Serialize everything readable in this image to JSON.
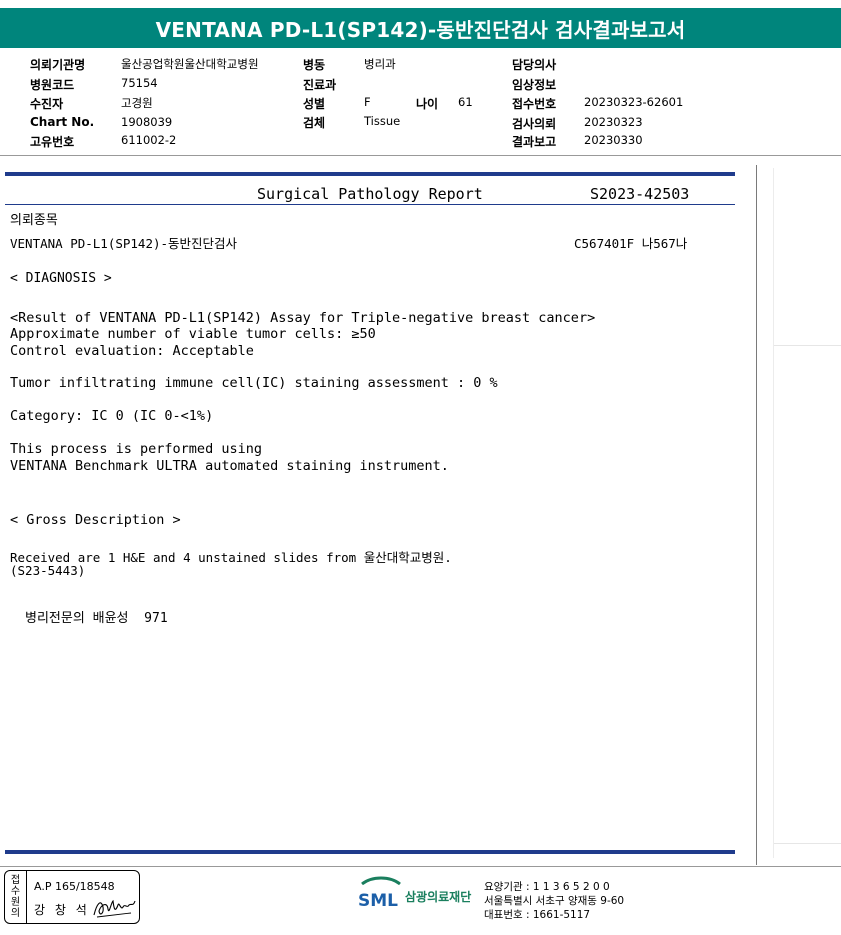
{
  "header": {
    "title": "VENTANA PD-L1(SP142)-동반진단검사 검사결과보고서"
  },
  "patient": {
    "col1": [
      {
        "label": "의뢰기관명",
        "value": "울산공업학원울산대학교병원"
      },
      {
        "label": "병원코드",
        "value": "75154"
      },
      {
        "label": "수진자",
        "value": "고경원"
      },
      {
        "label": "Chart No.",
        "value": "1908039"
      },
      {
        "label": "고유번호",
        "value": "611002-2"
      }
    ],
    "col2": [
      {
        "label": "병동",
        "value": "병리과"
      },
      {
        "label": "진료과",
        "value": ""
      },
      {
        "label": "성별",
        "value": "F"
      },
      {
        "label": "검체",
        "value": "Tissue"
      }
    ],
    "age": {
      "label": "나이",
      "value": "61"
    },
    "col3": [
      {
        "label": "담당의사",
        "value": ""
      },
      {
        "label": "임상정보",
        "value": ""
      },
      {
        "label": "접수번호",
        "value": "20230323-62601"
      },
      {
        "label": "검사의뢰",
        "value": "20230323"
      },
      {
        "label": "결과보고",
        "value": "20230330"
      }
    ]
  },
  "report": {
    "title": "Surgical Pathology Report",
    "report_no": "S2023-42503",
    "request_label": "의뢰종목",
    "request_item": "VENTANA PD-L1(SP142)-동반진단검사",
    "request_code": "C567401F 나567나",
    "diagnosis_header": "< DIAGNOSIS >",
    "result_header": "<Result of VENTANA PD-L1(SP142) Assay for Triple-negative breast cancer>",
    "viable_cells": "Approximate number of viable tumor cells: ≥50",
    "control": "Control evaluation: Acceptable",
    "ic_assessment": "Tumor infiltrating immune cell(IC) staining assessment : 0 %",
    "category": "Category: IC 0 (IC 0-<1%)",
    "process_1": "This process is performed using",
    "process_2": "VENTANA Benchmark ULTRA automated staining instrument.",
    "gross_header": "< Gross Description >",
    "gross_1": "Received are 1 H&E and 4 unstained slides from 울산대학교병원.",
    "gross_2": "(S23-5443)",
    "pathologist": "병리전문의 배윤성  971"
  },
  "footer": {
    "stamp_side": [
      "접",
      "수",
      "원",
      "의"
    ],
    "stamp_ap": "A.P 165/18548",
    "stamp_name": "강 창 석",
    "logo_abbr": "SML",
    "logo_name": "삼광의료재단",
    "contact_1": "요양기관 : 1 1 3 6 5 2 0 0",
    "contact_2": "서울특별시 서초구 양재동 9-60",
    "contact_3": "대표번호 : 1661-5117"
  },
  "colors": {
    "title_bar": "#00857c",
    "report_rule": "#1f3b8c",
    "logo_blue": "#1c5fa8",
    "logo_green": "#1a7f5e"
  }
}
